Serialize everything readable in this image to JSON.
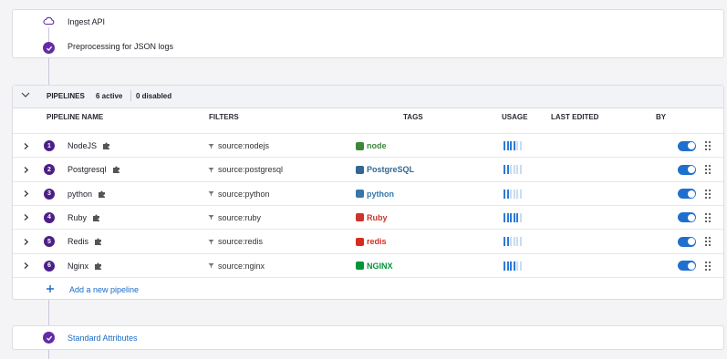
{
  "top_steps": [
    {
      "label": "Ingest API",
      "icon": "cloud-icon"
    },
    {
      "label": "Preprocessing for JSON logs",
      "icon": "check-circle-icon"
    }
  ],
  "pipelines_header": {
    "title": "PIPELINES",
    "active": "6 active",
    "disabled": "0 disabled"
  },
  "columns": {
    "name": "PIPELINE NAME",
    "filters": "FILTERS",
    "tags": "TAGS",
    "usage": "USAGE",
    "last_edited": "LAST EDITED",
    "by": "BY"
  },
  "pipelines": [
    {
      "number": "1",
      "name": "NodeJS",
      "filter": "source:nodejs",
      "tag_logo": "node",
      "tag_color": "#3c873a",
      "usage_bars": 4,
      "enabled": true
    },
    {
      "number": "2",
      "name": "Postgresql",
      "filter": "source:postgresql",
      "tag_logo": "PostgreSQL",
      "tag_color": "#336791",
      "usage_bars": 2,
      "enabled": true
    },
    {
      "number": "3",
      "name": "python",
      "filter": "source:python",
      "tag_logo": "python",
      "tag_color": "#3776ab",
      "usage_bars": 2,
      "enabled": true
    },
    {
      "number": "4",
      "name": "Ruby",
      "filter": "source:ruby",
      "tag_logo": "Ruby",
      "tag_color": "#cc342d",
      "usage_bars": 5,
      "enabled": true
    },
    {
      "number": "5",
      "name": "Redis",
      "filter": "source:redis",
      "tag_logo": "redis",
      "tag_color": "#d82c20",
      "usage_bars": 2,
      "enabled": true
    },
    {
      "number": "6",
      "name": "Nginx",
      "filter": "source:nginx",
      "tag_logo": "NGINX",
      "tag_color": "#009639",
      "usage_bars": 4,
      "enabled": true
    }
  ],
  "add_pipeline": "Add a new pipeline",
  "bottom_step": {
    "label": "Standard Attributes",
    "icon": "check-circle-icon"
  },
  "colors": {
    "accent": "#632ca6",
    "link": "#1a6bc7",
    "toggle": "#1f6fcf"
  }
}
